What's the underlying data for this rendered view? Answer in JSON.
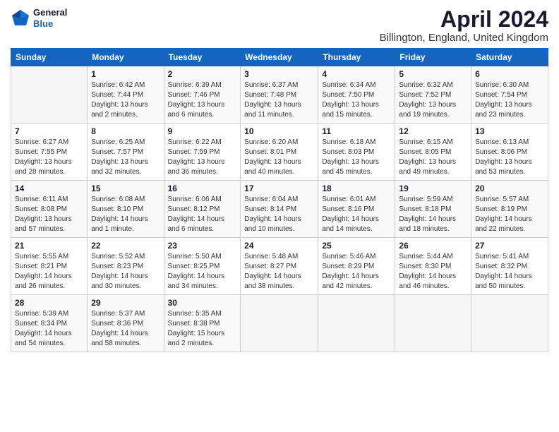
{
  "logo": {
    "text_general": "General",
    "text_blue": "Blue"
  },
  "header": {
    "title": "April 2024",
    "location": "Billington, England, United Kingdom"
  },
  "days_of_week": [
    "Sunday",
    "Monday",
    "Tuesday",
    "Wednesday",
    "Thursday",
    "Friday",
    "Saturday"
  ],
  "weeks": [
    [
      {
        "day": "",
        "info": ""
      },
      {
        "day": "1",
        "info": "Sunrise: 6:42 AM\nSunset: 7:44 PM\nDaylight: 13 hours\nand 2 minutes."
      },
      {
        "day": "2",
        "info": "Sunrise: 6:39 AM\nSunset: 7:46 PM\nDaylight: 13 hours\nand 6 minutes."
      },
      {
        "day": "3",
        "info": "Sunrise: 6:37 AM\nSunset: 7:48 PM\nDaylight: 13 hours\nand 11 minutes."
      },
      {
        "day": "4",
        "info": "Sunrise: 6:34 AM\nSunset: 7:50 PM\nDaylight: 13 hours\nand 15 minutes."
      },
      {
        "day": "5",
        "info": "Sunrise: 6:32 AM\nSunset: 7:52 PM\nDaylight: 13 hours\nand 19 minutes."
      },
      {
        "day": "6",
        "info": "Sunrise: 6:30 AM\nSunset: 7:54 PM\nDaylight: 13 hours\nand 23 minutes."
      }
    ],
    [
      {
        "day": "7",
        "info": "Sunrise: 6:27 AM\nSunset: 7:55 PM\nDaylight: 13 hours\nand 28 minutes."
      },
      {
        "day": "8",
        "info": "Sunrise: 6:25 AM\nSunset: 7:57 PM\nDaylight: 13 hours\nand 32 minutes."
      },
      {
        "day": "9",
        "info": "Sunrise: 6:22 AM\nSunset: 7:59 PM\nDaylight: 13 hours\nand 36 minutes."
      },
      {
        "day": "10",
        "info": "Sunrise: 6:20 AM\nSunset: 8:01 PM\nDaylight: 13 hours\nand 40 minutes."
      },
      {
        "day": "11",
        "info": "Sunrise: 6:18 AM\nSunset: 8:03 PM\nDaylight: 13 hours\nand 45 minutes."
      },
      {
        "day": "12",
        "info": "Sunrise: 6:15 AM\nSunset: 8:05 PM\nDaylight: 13 hours\nand 49 minutes."
      },
      {
        "day": "13",
        "info": "Sunrise: 6:13 AM\nSunset: 8:06 PM\nDaylight: 13 hours\nand 53 minutes."
      }
    ],
    [
      {
        "day": "14",
        "info": "Sunrise: 6:11 AM\nSunset: 8:08 PM\nDaylight: 13 hours\nand 57 minutes."
      },
      {
        "day": "15",
        "info": "Sunrise: 6:08 AM\nSunset: 8:10 PM\nDaylight: 14 hours\nand 1 minute."
      },
      {
        "day": "16",
        "info": "Sunrise: 6:06 AM\nSunset: 8:12 PM\nDaylight: 14 hours\nand 6 minutes."
      },
      {
        "day": "17",
        "info": "Sunrise: 6:04 AM\nSunset: 8:14 PM\nDaylight: 14 hours\nand 10 minutes."
      },
      {
        "day": "18",
        "info": "Sunrise: 6:01 AM\nSunset: 8:16 PM\nDaylight: 14 hours\nand 14 minutes."
      },
      {
        "day": "19",
        "info": "Sunrise: 5:59 AM\nSunset: 8:18 PM\nDaylight: 14 hours\nand 18 minutes."
      },
      {
        "day": "20",
        "info": "Sunrise: 5:57 AM\nSunset: 8:19 PM\nDaylight: 14 hours\nand 22 minutes."
      }
    ],
    [
      {
        "day": "21",
        "info": "Sunrise: 5:55 AM\nSunset: 8:21 PM\nDaylight: 14 hours\nand 26 minutes."
      },
      {
        "day": "22",
        "info": "Sunrise: 5:52 AM\nSunset: 8:23 PM\nDaylight: 14 hours\nand 30 minutes."
      },
      {
        "day": "23",
        "info": "Sunrise: 5:50 AM\nSunset: 8:25 PM\nDaylight: 14 hours\nand 34 minutes."
      },
      {
        "day": "24",
        "info": "Sunrise: 5:48 AM\nSunset: 8:27 PM\nDaylight: 14 hours\nand 38 minutes."
      },
      {
        "day": "25",
        "info": "Sunrise: 5:46 AM\nSunset: 8:29 PM\nDaylight: 14 hours\nand 42 minutes."
      },
      {
        "day": "26",
        "info": "Sunrise: 5:44 AM\nSunset: 8:30 PM\nDaylight: 14 hours\nand 46 minutes."
      },
      {
        "day": "27",
        "info": "Sunrise: 5:41 AM\nSunset: 8:32 PM\nDaylight: 14 hours\nand 50 minutes."
      }
    ],
    [
      {
        "day": "28",
        "info": "Sunrise: 5:39 AM\nSunset: 8:34 PM\nDaylight: 14 hours\nand 54 minutes."
      },
      {
        "day": "29",
        "info": "Sunrise: 5:37 AM\nSunset: 8:36 PM\nDaylight: 14 hours\nand 58 minutes."
      },
      {
        "day": "30",
        "info": "Sunrise: 5:35 AM\nSunset: 8:38 PM\nDaylight: 15 hours\nand 2 minutes."
      },
      {
        "day": "",
        "info": ""
      },
      {
        "day": "",
        "info": ""
      },
      {
        "day": "",
        "info": ""
      },
      {
        "day": "",
        "info": ""
      }
    ]
  ]
}
